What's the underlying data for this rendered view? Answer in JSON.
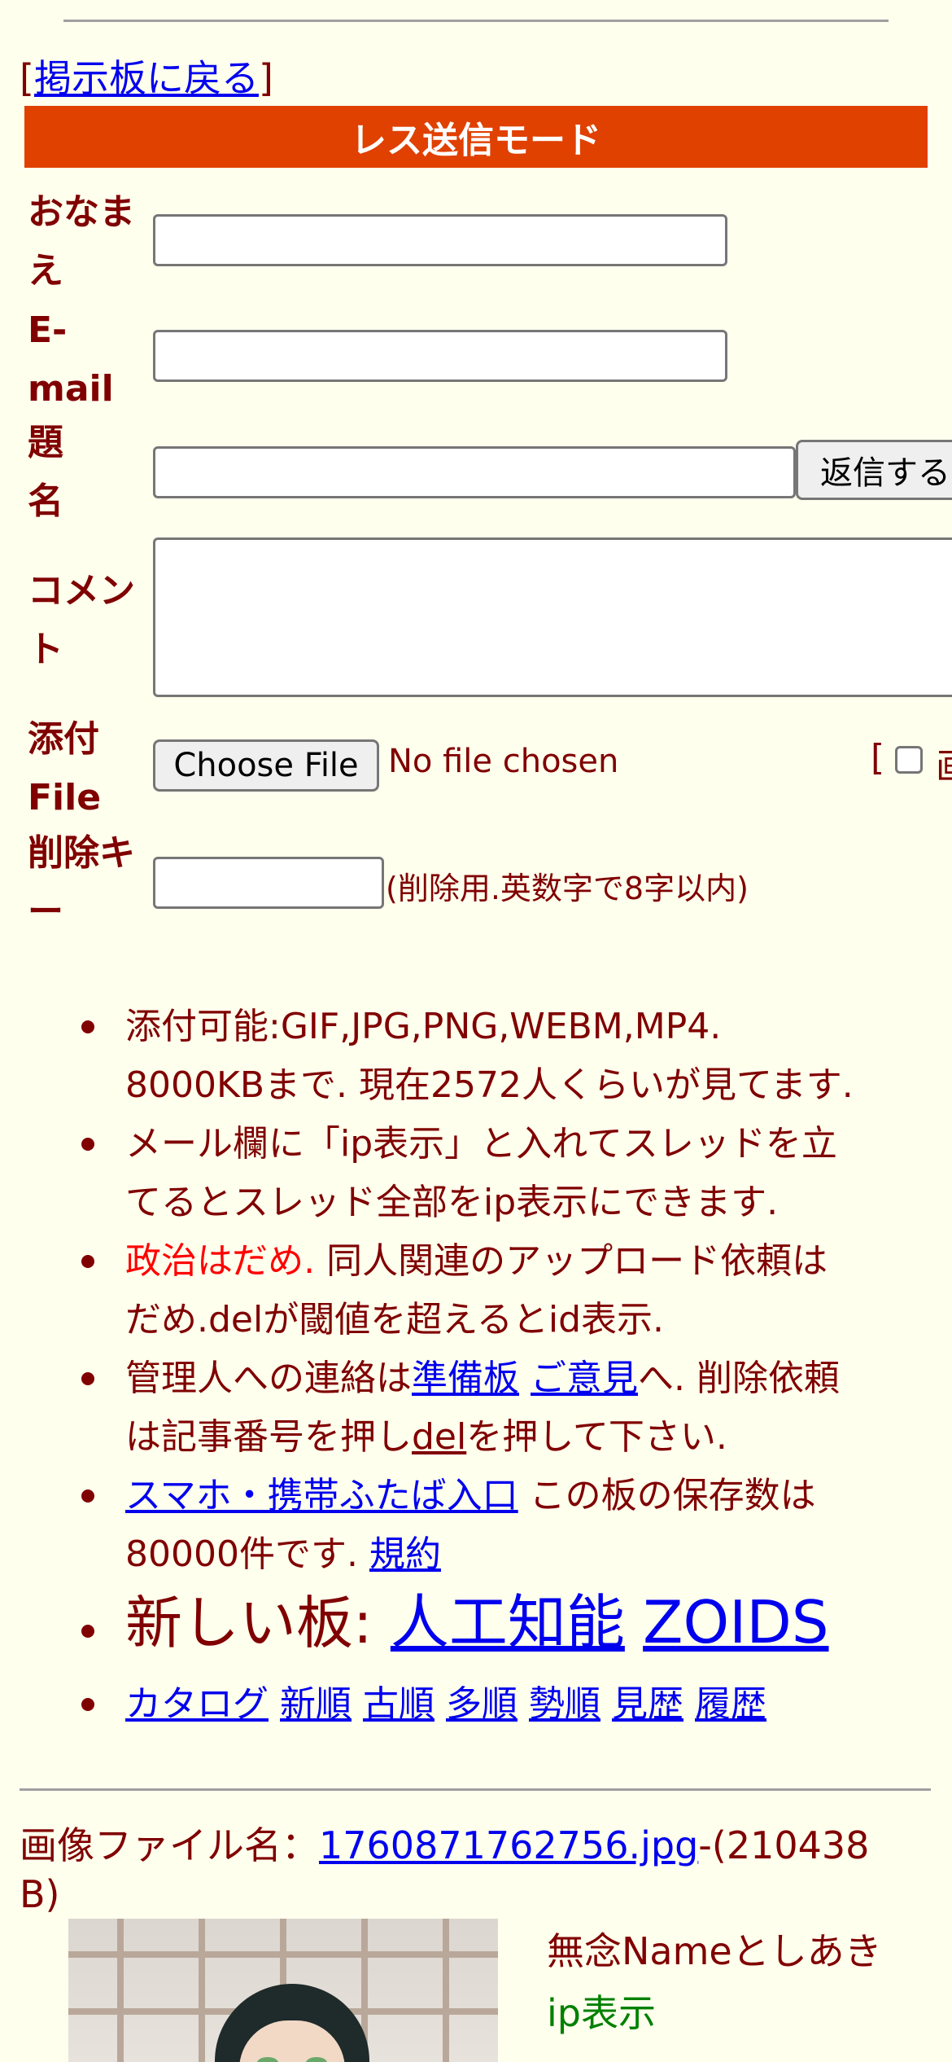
{
  "back": {
    "open": "[",
    "label": "掲示板に戻る",
    "close": "]"
  },
  "mode_title": "レス送信モード",
  "form": {
    "name_label_1": "おなま",
    "name_label_2": "え",
    "email_label_1": "E-",
    "email_label_2": "mail",
    "subject_label_1": "題",
    "subject_label_2": "名",
    "submit_label": "返信する",
    "comment_label_1": "コメン",
    "comment_label_2": "ト",
    "file_label_1": "添付",
    "file_label_2": "File",
    "choose_file": "Choose File",
    "no_file": "No file chosen",
    "img_bracket": "[",
    "img_partial": "画",
    "delkey_label_1": "削除キ",
    "delkey_label_2": "ー",
    "delkey_note": "(削除用.英数字で8字以内)"
  },
  "rules": {
    "r1_line1": "添付可能:GIF,JPG,PNG,WEBM,MP4.",
    "r1_line2": "8000KBまで. 現在2572人くらいが見てます.",
    "r2_line1": "メール欄に「ip表示」と入れてスレッドを立",
    "r2_line2": "てるとスレッド全部をip表示にできます.",
    "r3_red": "政治はだめ.",
    "r3_rest": " 同人関連のアップロード依頼は",
    "r3_line2": "だめ.delが閾値を超えるとid表示.",
    "r4_pre": "管理人への連絡は",
    "r4_link1": "準備板",
    "r4_link2": "ご意見",
    "r4_post": "へ. 削除依頼",
    "r4_line2_pre": "は記事番号を押し",
    "r4_line2_link": "del",
    "r4_line2_post": "を押して下さい.",
    "r5_link": "スマホ・携帯ふたば入口",
    "r5_rest": " この板の保存数は",
    "r5_line2": "80000件です.",
    "r5_link2": "規約",
    "new_boards_label": "新しい板:",
    "new_board_1": "人工知能",
    "new_board_2": "ZOIDS",
    "nav": [
      "カタログ",
      "新順",
      "古順",
      "多順",
      "勢順",
      "見歴",
      "履歴"
    ]
  },
  "file": {
    "prefix": "画像ファイル名：",
    "filename": "1760871762756.jpg",
    "size": "-(210438",
    "size_cont": "B)"
  },
  "post": {
    "name": "無念Nameとしあき",
    "ip": "ip表示"
  }
}
